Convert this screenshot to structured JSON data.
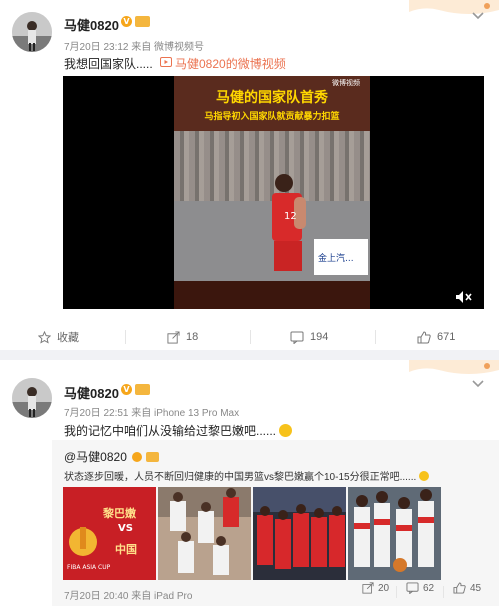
{
  "post1": {
    "username": "马健0820",
    "meta": "7月20日 23:12 来自 微博视频号",
    "text": "我想回国家队.....",
    "link_text": "马健0820的微博视频",
    "video": {
      "title_line1": "马健的国家队首秀",
      "title_line2": "马指导初入国家队就贡献暴力扣篮",
      "watermark": "微博视频",
      "jersey_number": "12",
      "banner_text": "金上汽..."
    },
    "actions": {
      "collect_label": "收藏",
      "share_count": "18",
      "comment_count": "194",
      "like_count": "671"
    }
  },
  "post2": {
    "username": "马健0820",
    "meta": "7月20日 22:51 来自 iPhone 13 Pro Max",
    "text": "我的记忆中咱们从没输给过黎巴嫩吧......",
    "retweet": {
      "username": "@马健0820",
      "text": "状态逐步回暖，人员不断回归健康的中国男篮vs黎巴嫩赢个10-15分很正常吧......",
      "thumb1": {
        "caption_team1": "黎巴嫩",
        "caption_vs": "VS",
        "caption_team2": "中国",
        "cup_label": "FIBA ASIA CUP"
      },
      "meta": "7月20日 20:40 来自 iPad Pro",
      "share_count": "20",
      "comment_count": "62",
      "like_count": "45"
    }
  },
  "colors": {
    "accent_orange": "#eb7350",
    "divider": "#f1f2f5",
    "retweet_bg": "#f6f6f6",
    "video_title": "#ffd700"
  }
}
